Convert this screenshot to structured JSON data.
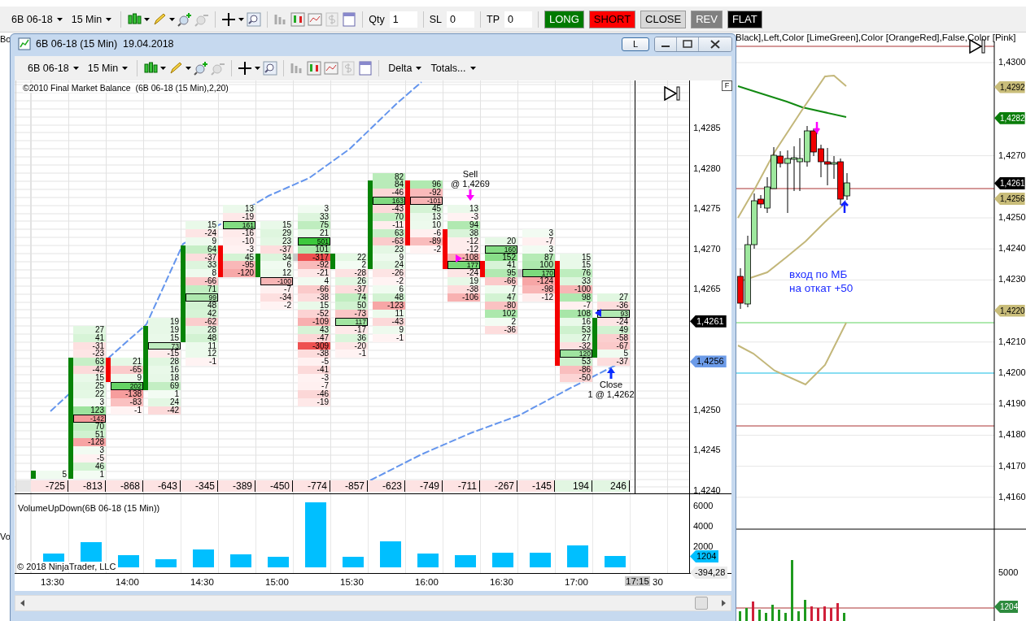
{
  "main_toolbar": {
    "instrument": "6B 06-18",
    "interval": "15 Min",
    "fields": [
      {
        "label": "Qty",
        "value": "1"
      },
      {
        "label": "SL",
        "value": "0"
      },
      {
        "label": "TP",
        "value": "0"
      }
    ],
    "buttons": [
      {
        "label": "LONG",
        "kind": "long"
      },
      {
        "label": "SHORT",
        "kind": "short"
      },
      {
        "label": "CLOSE",
        "kind": "close"
      },
      {
        "label": "REV",
        "kind": "rev"
      },
      {
        "label": "FLAT",
        "kind": "flat"
      }
    ]
  },
  "main_chart": {
    "legend": "Black],Left,Color [LimeGreen],Color [OrangeRed],False,Color [Pink]",
    "side_legends": [
      "Bo",
      "Vo"
    ],
    "note": [
      "вход по МБ",
      "на откат +50"
    ],
    "price_axis": {
      "ticks": [
        "1,4300",
        "1,4270",
        "1,4250",
        "1,4240",
        "1,4230",
        "1,4210",
        "1,4200",
        "1,4190",
        "1,4180",
        "1,4170",
        "1,4160"
      ],
      "markers": [
        {
          "label": "1,4292",
          "color": "#c9bd7a"
        },
        {
          "label": "1,4282",
          "color": "#0a7d0a"
        },
        {
          "label": "1,4261",
          "color": "#000000"
        },
        {
          "label": "1,4256",
          "color": "#c9bd7a"
        },
        {
          "label": "1,4220",
          "color": "#c9bd7a"
        }
      ]
    },
    "volume_axis": {
      "tick": "5000",
      "marker": {
        "label": "1204",
        "color": "#2e8b3e"
      }
    }
  },
  "window": {
    "title": "6B 06-18 (15 Min)  19.04.2018",
    "mode_button": "L",
    "toolbar": {
      "instrument": "6B 06-18",
      "interval": "15 Min",
      "delta": "Delta",
      "totals": "Totals..."
    },
    "indicator_label": "©2010 Final Market Balance  (6B 06-18 (15 Min),2,20)",
    "panel_button": "F",
    "price_axis": {
      "ticks": [
        "1,4285",
        "1,4280",
        "1,4275",
        "1,4270",
        "1,4265",
        "1,4250",
        "1,4245",
        "1,4240"
      ],
      "markers": [
        {
          "label": "1,4261",
          "color": "#000000"
        },
        {
          "label": "1,4256",
          "color": "#6c9be8"
        }
      ]
    },
    "footprint": {
      "columns": [
        {
          "kind": "up",
          "cells": [
            null,
            null,
            null,
            null,
            null,
            null,
            null,
            null,
            null,
            null,
            null,
            null,
            null,
            null,
            null,
            null,
            null,
            null,
            null,
            null,
            null,
            null,
            null,
            null,
            null,
            null,
            null,
            null,
            null,
            null,
            null,
            null,
            null,
            null,
            null,
            null,
            null,
            {
              "value": "5",
              "body": true,
              "poc": false
            }
          ]
        },
        {
          "kind": "up",
          "cells": [
            null,
            null,
            null,
            null,
            null,
            null,
            null,
            null,
            null,
            null,
            null,
            null,
            null,
            null,
            null,
            null,
            null,
            null,
            null,
            {
              "value": "27",
              "body": false,
              "poc": false
            },
            {
              "value": "41",
              "body": false,
              "poc": false
            },
            {
              "value": "-31",
              "body": false,
              "poc": false
            },
            {
              "value": "-23",
              "body": false,
              "poc": false
            },
            {
              "value": "63",
              "body": true,
              "poc": false
            },
            {
              "value": "-42",
              "body": true,
              "poc": false
            },
            {
              "value": "15",
              "body": true,
              "poc": false
            },
            {
              "value": "25",
              "body": true,
              "poc": false
            },
            {
              "value": "22",
              "body": true,
              "poc": false
            },
            {
              "value": "3",
              "body": true,
              "poc": false
            },
            {
              "value": "123",
              "body": true,
              "poc": false
            },
            {
              "value": "-142",
              "body": true,
              "poc": true
            },
            {
              "value": "70",
              "body": true,
              "poc": false
            },
            {
              "value": "51",
              "body": true,
              "poc": false
            },
            {
              "value": "-128",
              "body": true,
              "poc": false
            },
            {
              "value": "3",
              "body": true,
              "poc": false
            },
            {
              "value": "-5",
              "body": true,
              "poc": false
            },
            {
              "value": "46",
              "body": true,
              "poc": false
            },
            {
              "value": "1",
              "body": true,
              "poc": false
            }
          ]
        },
        {
          "kind": "down",
          "cells": [
            null,
            null,
            null,
            null,
            null,
            null,
            null,
            null,
            null,
            null,
            null,
            null,
            null,
            null,
            null,
            null,
            null,
            null,
            null,
            null,
            null,
            null,
            null,
            {
              "value": "21",
              "body": true,
              "poc": false
            },
            {
              "value": "-65",
              "body": true,
              "poc": false
            },
            {
              "value": "9",
              "body": true,
              "poc": false
            },
            {
              "value": "202",
              "body": false,
              "poc": true
            },
            {
              "value": "-138",
              "body": false,
              "poc": false
            },
            {
              "value": "-83",
              "body": false,
              "poc": false
            },
            {
              "value": "-1",
              "body": false,
              "poc": false
            }
          ]
        },
        {
          "kind": "up",
          "cells": [
            null,
            null,
            null,
            null,
            null,
            null,
            null,
            null,
            null,
            null,
            null,
            null,
            null,
            null,
            null,
            null,
            null,
            null,
            {
              "value": "19",
              "body": false,
              "poc": false
            },
            {
              "value": "19",
              "body": true,
              "poc": false
            },
            {
              "value": "15",
              "body": true,
              "poc": false
            },
            {
              "value": "73",
              "body": true,
              "poc": true
            },
            {
              "value": "-15",
              "body": true,
              "poc": false
            },
            {
              "value": "28",
              "body": true,
              "poc": false
            },
            {
              "value": "16",
              "body": true,
              "poc": false
            },
            {
              "value": "18",
              "body": true,
              "poc": false
            },
            {
              "value": "69",
              "body": true,
              "poc": false
            },
            {
              "value": "1",
              "body": false,
              "poc": false
            },
            {
              "value": "24",
              "body": false,
              "poc": false
            },
            {
              "value": "-42",
              "body": false,
              "poc": false
            }
          ]
        },
        {
          "kind": "up",
          "cells": [
            null,
            null,
            null,
            null,
            null,
            null,
            {
              "value": "15",
              "body": false,
              "poc": false
            },
            {
              "value": "-24",
              "body": false,
              "poc": false
            },
            {
              "value": "9",
              "body": false,
              "poc": false
            },
            {
              "value": "64",
              "body": true,
              "poc": false
            },
            {
              "value": "-37",
              "body": true,
              "poc": false
            },
            {
              "value": "33",
              "body": true,
              "poc": false
            },
            {
              "value": "8",
              "body": true,
              "poc": false
            },
            {
              "value": "-66",
              "body": true,
              "poc": false
            },
            {
              "value": "71",
              "body": true,
              "poc": false
            },
            {
              "value": "99",
              "body": true,
              "poc": true
            },
            {
              "value": "48",
              "body": true,
              "poc": false
            },
            {
              "value": "42",
              "body": true,
              "poc": false
            },
            {
              "value": "-62",
              "body": true,
              "poc": false
            },
            {
              "value": "28",
              "body": true,
              "poc": false
            },
            {
              "value": "48",
              "body": true,
              "poc": false
            },
            {
              "value": "11",
              "body": false,
              "poc": false
            },
            {
              "value": "12",
              "body": false,
              "poc": false
            },
            {
              "value": "-1",
              "body": false,
              "poc": false
            }
          ]
        },
        {
          "kind": "down",
          "cells": [
            null,
            null,
            null,
            null,
            {
              "value": "13",
              "body": false,
              "poc": false
            },
            {
              "value": "-19",
              "body": false,
              "poc": false
            },
            {
              "value": "161",
              "body": false,
              "poc": true
            },
            {
              "value": "-16",
              "body": false,
              "poc": false
            },
            {
              "value": "-10",
              "body": false,
              "poc": false
            },
            {
              "value": "-3",
              "body": true,
              "poc": false
            },
            {
              "value": "45",
              "body": true,
              "poc": false
            },
            {
              "value": "-95",
              "body": true,
              "poc": false
            },
            {
              "value": "-120",
              "body": true,
              "poc": false
            }
          ]
        },
        {
          "kind": "up",
          "cells": [
            null,
            null,
            null,
            null,
            null,
            null,
            {
              "value": "15",
              "body": false,
              "poc": false
            },
            {
              "value": "29",
              "body": false,
              "poc": false
            },
            {
              "value": "23",
              "body": false,
              "poc": false
            },
            {
              "value": "-37",
              "body": false,
              "poc": false
            },
            {
              "value": "34",
              "body": true,
              "poc": false
            },
            {
              "value": "6",
              "body": true,
              "poc": false
            },
            {
              "value": "12",
              "body": true,
              "poc": false
            },
            {
              "value": "-100",
              "body": false,
              "poc": true
            },
            {
              "value": "-7",
              "body": false,
              "poc": false
            },
            {
              "value": "-34",
              "body": false,
              "poc": false
            },
            {
              "value": "-2",
              "body": false,
              "poc": false
            }
          ]
        },
        {
          "kind": "doji",
          "cells": [
            null,
            null,
            null,
            null,
            {
              "value": "3",
              "body": false,
              "poc": false
            },
            {
              "value": "33",
              "body": false,
              "poc": false
            },
            {
              "value": "75",
              "body": false,
              "poc": false
            },
            {
              "value": "21",
              "body": false,
              "poc": false
            },
            {
              "value": "501",
              "body": false,
              "poc": true
            },
            {
              "value": "101",
              "body": false,
              "poc": false
            },
            {
              "value": "-317",
              "body": true,
              "poc": false
            },
            {
              "value": "-92",
              "body": false,
              "poc": false
            },
            {
              "value": "-21",
              "body": false,
              "poc": false
            },
            {
              "value": "4",
              "body": false,
              "poc": false
            },
            {
              "value": "-66",
              "body": false,
              "poc": false
            },
            {
              "value": "-38",
              "body": false,
              "poc": false
            },
            {
              "value": "15",
              "body": false,
              "poc": false
            },
            {
              "value": "-52",
              "body": false,
              "poc": false
            },
            {
              "value": "-109",
              "body": false,
              "poc": false
            },
            {
              "value": "43",
              "body": false,
              "poc": false
            },
            {
              "value": "-47",
              "body": false,
              "poc": false
            },
            {
              "value": "-309",
              "body": false,
              "poc": false
            },
            {
              "value": "-38",
              "body": false,
              "poc": false
            },
            {
              "value": "-5",
              "body": false,
              "poc": false
            },
            {
              "value": "-41",
              "body": false,
              "poc": false
            },
            {
              "value": "-3",
              "body": false,
              "poc": false
            },
            {
              "value": "-7",
              "body": false,
              "poc": false
            },
            {
              "value": "-46",
              "body": false,
              "poc": false
            },
            {
              "value": "-19",
              "body": false,
              "poc": false
            }
          ]
        },
        {
          "kind": "up",
          "cells": [
            null,
            null,
            null,
            null,
            null,
            null,
            null,
            null,
            null,
            null,
            {
              "value": "22",
              "body": true,
              "poc": false
            },
            {
              "value": "2",
              "body": true,
              "poc": false
            },
            {
              "value": "-28",
              "body": false,
              "poc": false
            },
            {
              "value": "26",
              "body": false,
              "poc": false
            },
            {
              "value": "-37",
              "body": false,
              "poc": false
            },
            {
              "value": "74",
              "body": false,
              "poc": false
            },
            {
              "value": "50",
              "body": false,
              "poc": false
            },
            {
              "value": "-73",
              "body": false,
              "poc": false
            },
            {
              "value": "117",
              "body": false,
              "poc": true
            },
            {
              "value": "-17",
              "body": false,
              "poc": false
            },
            {
              "value": "36",
              "body": false,
              "poc": false
            },
            {
              "value": "-20",
              "body": false,
              "poc": false
            },
            {
              "value": "-1",
              "body": false,
              "poc": false
            }
          ]
        },
        {
          "kind": "up",
          "cells": [
            {
              "value": "82",
              "body": false,
              "poc": false
            },
            {
              "value": "84",
              "body": true,
              "poc": false
            },
            {
              "value": "-46",
              "body": true,
              "poc": false
            },
            {
              "value": "163",
              "body": true,
              "poc": true
            },
            {
              "value": "-43",
              "body": true,
              "poc": false
            },
            {
              "value": "70",
              "body": true,
              "poc": false
            },
            {
              "value": "-11",
              "body": true,
              "poc": false
            },
            {
              "value": "63",
              "body": true,
              "poc": false
            },
            {
              "value": "-63",
              "body": true,
              "poc": false
            },
            {
              "value": "23",
              "body": true,
              "poc": false
            },
            {
              "value": "9",
              "body": true,
              "poc": false
            },
            {
              "value": "24",
              "body": true,
              "poc": false
            },
            {
              "value": "-26",
              "body": false,
              "poc": false
            },
            {
              "value": "-2",
              "body": false,
              "poc": false
            },
            {
              "value": "6",
              "body": false,
              "poc": false
            },
            {
              "value": "48",
              "body": false,
              "poc": false
            },
            {
              "value": "-123",
              "body": false,
              "poc": false
            },
            {
              "value": "11",
              "body": false,
              "poc": false
            },
            {
              "value": "-43",
              "body": false,
              "poc": false
            },
            {
              "value": "9",
              "body": false,
              "poc": false
            },
            {
              "value": "-1",
              "body": false,
              "poc": false
            }
          ]
        },
        {
          "kind": "down",
          "cells": [
            null,
            {
              "value": "96",
              "body": true,
              "poc": false
            },
            {
              "value": "-92",
              "body": true,
              "poc": false
            },
            {
              "value": "-101",
              "body": true,
              "poc": true
            },
            {
              "value": "45",
              "body": true,
              "poc": false
            },
            {
              "value": "13",
              "body": true,
              "poc": false
            },
            {
              "value": "10",
              "body": true,
              "poc": false
            },
            {
              "value": "-6",
              "body": true,
              "poc": false
            },
            {
              "value": "-89",
              "body": true,
              "poc": false
            },
            {
              "value": "-2",
              "body": false,
              "poc": false
            }
          ]
        },
        {
          "kind": "down",
          "trade": {
            "kind": "sell",
            "label": "Sell",
            "detail": "@ 1,4269"
          },
          "cells": [
            null,
            null,
            null,
            null,
            {
              "value": "13",
              "body": false,
              "poc": false
            },
            {
              "value": "-3",
              "body": false,
              "poc": false
            },
            {
              "value": "94",
              "body": false,
              "poc": false
            },
            {
              "value": "38",
              "body": true,
              "poc": false
            },
            {
              "value": "-12",
              "body": true,
              "poc": false
            },
            {
              "value": "-12",
              "body": true,
              "poc": false
            },
            {
              "value": "-108",
              "body": true,
              "poc": false
            },
            {
              "value": "177",
              "body": true,
              "poc": true
            },
            {
              "value": "-24",
              "body": false,
              "poc": false
            },
            {
              "value": "19",
              "body": false,
              "poc": false
            },
            {
              "value": "-38",
              "body": false,
              "poc": false
            },
            {
              "value": "-106",
              "body": false,
              "poc": false
            }
          ]
        },
        {
          "kind": "down",
          "cells": [
            null,
            null,
            null,
            null,
            null,
            null,
            null,
            null,
            {
              "value": "20",
              "body": false,
              "poc": false
            },
            {
              "value": "160",
              "body": false,
              "poc": true
            },
            {
              "value": "152",
              "body": false,
              "poc": false
            },
            {
              "value": "41",
              "body": true,
              "poc": false
            },
            {
              "value": "95",
              "body": true,
              "poc": false
            },
            {
              "value": "-66",
              "body": false,
              "poc": false
            },
            {
              "value": "7",
              "body": false,
              "poc": false
            },
            {
              "value": "47",
              "body": false,
              "poc": false
            },
            {
              "value": "-80",
              "body": false,
              "poc": false
            },
            {
              "value": "102",
              "body": false,
              "poc": false
            },
            {
              "value": "2",
              "body": false,
              "poc": false
            },
            {
              "value": "-36",
              "body": false,
              "poc": false
            }
          ]
        },
        {
          "kind": "doji",
          "cells": [
            null,
            null,
            null,
            null,
            null,
            null,
            null,
            {
              "value": "3",
              "body": false,
              "poc": false
            },
            {
              "value": "-7",
              "body": false,
              "poc": false
            },
            {
              "value": "3",
              "body": false,
              "poc": false
            },
            {
              "value": "87",
              "body": false,
              "poc": false
            },
            {
              "value": "100",
              "body": false,
              "poc": false
            },
            {
              "value": "170",
              "body": true,
              "poc": true
            },
            {
              "value": "-124",
              "body": false,
              "poc": false
            },
            {
              "value": "-98",
              "body": false,
              "poc": false
            },
            {
              "value": "-12",
              "body": false,
              "poc": false
            }
          ]
        },
        {
          "kind": "down",
          "cells": [
            null,
            null,
            null,
            null,
            null,
            null,
            null,
            null,
            null,
            null,
            {
              "value": "15",
              "body": false,
              "poc": false
            },
            {
              "value": "15",
              "body": true,
              "poc": false
            },
            {
              "value": "76",
              "body": true,
              "poc": false
            },
            {
              "value": "33",
              "body": true,
              "poc": false
            },
            {
              "value": "-100",
              "body": true,
              "poc": false
            },
            {
              "value": "98",
              "body": true,
              "poc": false
            },
            {
              "value": "-7",
              "body": true,
              "poc": false
            },
            {
              "value": "108",
              "body": true,
              "poc": false
            },
            {
              "value": "16",
              "body": true,
              "poc": false
            },
            {
              "value": "53",
              "body": true,
              "poc": false
            },
            {
              "value": "27",
              "body": true,
              "poc": false
            },
            {
              "value": "-32",
              "body": true,
              "poc": false
            },
            {
              "value": "120",
              "body": true,
              "poc": true
            },
            {
              "value": "53",
              "body": true,
              "poc": false
            },
            {
              "value": "-86",
              "body": false,
              "poc": false
            },
            {
              "value": "-50",
              "body": false,
              "poc": false
            }
          ]
        },
        {
          "kind": "up",
          "trade": {
            "kind": "close",
            "label": "Close",
            "detail": "1 @ 1,4262"
          },
          "cells": [
            null,
            null,
            null,
            null,
            null,
            null,
            null,
            null,
            null,
            null,
            null,
            null,
            null,
            null,
            null,
            {
              "value": "27",
              "body": false,
              "poc": false
            },
            {
              "value": "-36",
              "body": false,
              "poc": false
            },
            {
              "value": "93",
              "body": false,
              "poc": true
            },
            {
              "value": "-24",
              "body": true,
              "poc": false
            },
            {
              "value": "49",
              "body": true,
              "poc": false
            },
            {
              "value": "-58",
              "body": true,
              "poc": false
            },
            {
              "value": "-67",
              "body": true,
              "poc": false
            },
            {
              "value": "5",
              "body": true,
              "poc": false
            },
            {
              "value": "-37",
              "body": false,
              "poc": false
            }
          ]
        }
      ],
      "totals": [
        "-725",
        "-813",
        "-868",
        "-643",
        "-345",
        "-389",
        "-450",
        "-774",
        "-857",
        "-623",
        "-749",
        "-711",
        "-267",
        "-145",
        "194",
        "246"
      ]
    },
    "volume": {
      "label": "VolumeUpDown(6B 06-18 (15 Min))",
      "copyright": "© 2018 NinjaTrader, LLC",
      "axis_labels": [
        "6000",
        "4000",
        "2000"
      ],
      "time_labels": [
        "13:30",
        "14:00",
        "14:30",
        "15:00",
        "15:30",
        "16:00",
        "16:30",
        "17:00"
      ],
      "markers": [
        {
          "label": "1204",
          "kind": "volume"
        },
        {
          "label": "-394,28",
          "kind": "aux"
        }
      ]
    },
    "time_cursor": {
      "label": "17:15",
      "tail": "30"
    }
  }
}
